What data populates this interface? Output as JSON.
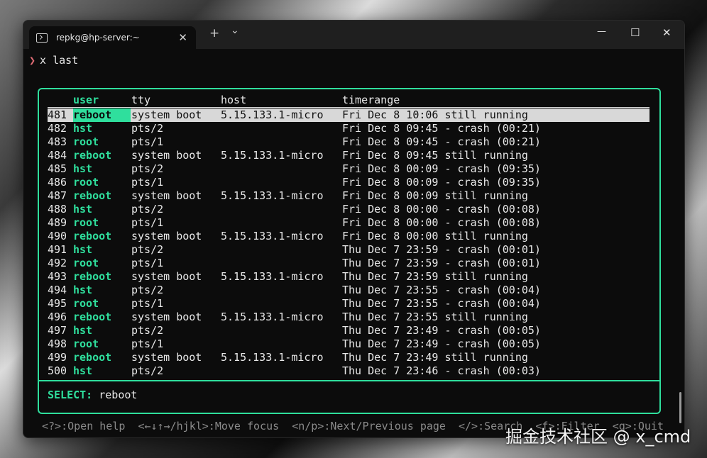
{
  "window": {
    "tab_title": "repkg@hp-server:~",
    "tab_close": "✕",
    "new_tab": "+",
    "dropdown": "⌄",
    "minimize": "—",
    "maximize": "☐",
    "close": "✕"
  },
  "prompt": {
    "chevron": "❯",
    "command": "x last"
  },
  "table": {
    "headers": {
      "user": "user",
      "tty": "tty",
      "host": "host",
      "timerange": "timerange"
    },
    "rows": [
      {
        "num": "481",
        "user": "reboot",
        "tty": "system boot",
        "host": "5.15.133.1-micro",
        "time": "Fri Dec 8 10:06 still running"
      },
      {
        "num": "482",
        "user": "hst",
        "tty": "pts/2",
        "host": "",
        "time": "Fri Dec 8 09:45 - crash (00:21)"
      },
      {
        "num": "483",
        "user": "root",
        "tty": "pts/1",
        "host": "",
        "time": "Fri Dec 8 09:45 - crash (00:21)"
      },
      {
        "num": "484",
        "user": "reboot",
        "tty": "system boot",
        "host": "5.15.133.1-micro",
        "time": "Fri Dec 8 09:45 still running"
      },
      {
        "num": "485",
        "user": "hst",
        "tty": "pts/2",
        "host": "",
        "time": "Fri Dec 8 00:09 - crash (09:35)"
      },
      {
        "num": "486",
        "user": "root",
        "tty": "pts/1",
        "host": "",
        "time": "Fri Dec 8 00:09 - crash (09:35)"
      },
      {
        "num": "487",
        "user": "reboot",
        "tty": "system boot",
        "host": "5.15.133.1-micro",
        "time": "Fri Dec 8 00:09 still running"
      },
      {
        "num": "488",
        "user": "hst",
        "tty": "pts/2",
        "host": "",
        "time": "Fri Dec 8 00:00 - crash (00:08)"
      },
      {
        "num": "489",
        "user": "root",
        "tty": "pts/1",
        "host": "",
        "time": "Fri Dec 8 00:00 - crash (00:08)"
      },
      {
        "num": "490",
        "user": "reboot",
        "tty": "system boot",
        "host": "5.15.133.1-micro",
        "time": "Fri Dec 8 00:00 still running"
      },
      {
        "num": "491",
        "user": "hst",
        "tty": "pts/2",
        "host": "",
        "time": "Thu Dec 7 23:59 - crash (00:01)"
      },
      {
        "num": "492",
        "user": "root",
        "tty": "pts/1",
        "host": "",
        "time": "Thu Dec 7 23:59 - crash (00:01)"
      },
      {
        "num": "493",
        "user": "reboot",
        "tty": "system boot",
        "host": "5.15.133.1-micro",
        "time": "Thu Dec 7 23:59 still running"
      },
      {
        "num": "494",
        "user": "hst",
        "tty": "pts/2",
        "host": "",
        "time": "Thu Dec 7 23:55 - crash (00:04)"
      },
      {
        "num": "495",
        "user": "root",
        "tty": "pts/1",
        "host": "",
        "time": "Thu Dec 7 23:55 - crash (00:04)"
      },
      {
        "num": "496",
        "user": "reboot",
        "tty": "system boot",
        "host": "5.15.133.1-micro",
        "time": "Thu Dec 7 23:55 still running"
      },
      {
        "num": "497",
        "user": "hst",
        "tty": "pts/2",
        "host": "",
        "time": "Thu Dec 7 23:49 - crash (00:05)"
      },
      {
        "num": "498",
        "user": "root",
        "tty": "pts/1",
        "host": "",
        "time": "Thu Dec 7 23:49 - crash (00:05)"
      },
      {
        "num": "499",
        "user": "reboot",
        "tty": "system boot",
        "host": "5.15.133.1-micro",
        "time": "Thu Dec 7 23:49 still running"
      },
      {
        "num": "500",
        "user": "hst",
        "tty": "pts/2",
        "host": "",
        "time": "Thu Dec 7 23:46 - crash (00:03)"
      }
    ]
  },
  "select": {
    "label": "SELECT:",
    "value": "reboot"
  },
  "help": "<?>:Open help  <←↓↑→/hjkl>:Move focus  <n/p>:Next/Previous page  </>:Search  <f>:Filter  <q>:Quit",
  "watermark": "掘金技术社区 @ x_cmd",
  "colors": {
    "accent": "#2fdf9d",
    "prompt_chevron": "#e06c75",
    "background": "#0c0c0c"
  }
}
